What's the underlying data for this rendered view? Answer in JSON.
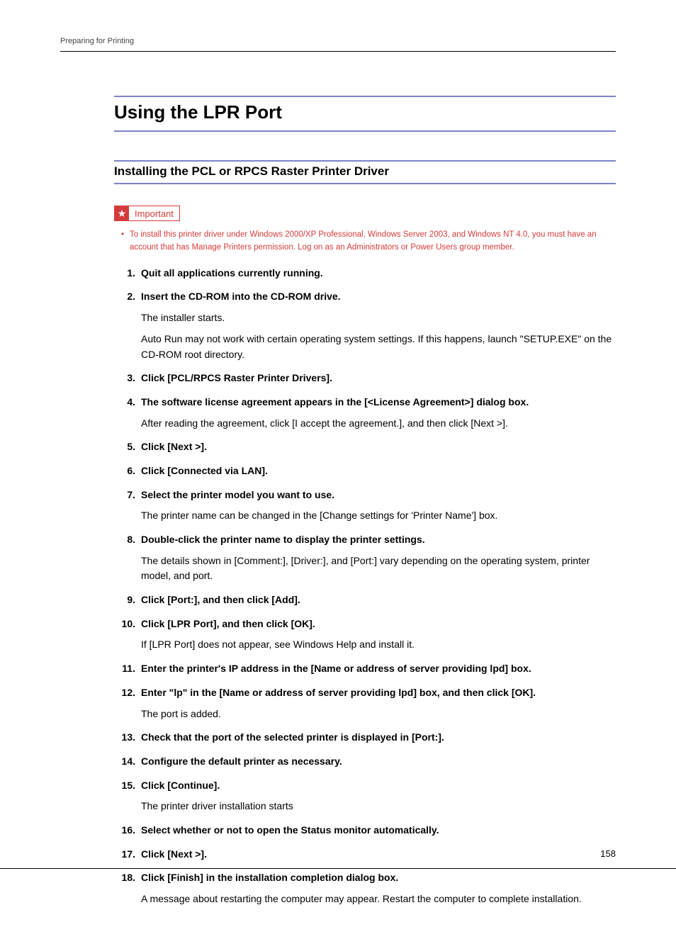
{
  "running_head": "Preparing for Printing",
  "page_title": "Using the LPR Port",
  "section_title": "Installing the PCL or RPCS Raster Printer Driver",
  "important_label": "Important",
  "important_note": "To install this printer driver under Windows 2000/XP Professional, Windows Server 2003, and Windows NT 4.0, you must have an account that has Manage Printers permission. Log on as an Administrators or Power Users group member.",
  "steps": [
    {
      "title": "Quit all applications currently running.",
      "body": []
    },
    {
      "title": "Insert the CD-ROM into the CD-ROM drive.",
      "body": [
        "The installer starts.",
        "Auto Run may not work with certain operating system settings. If this happens, launch \"SETUP.EXE\" on the CD-ROM root directory."
      ]
    },
    {
      "title": "Click [PCL/RPCS Raster Printer Drivers].",
      "body": []
    },
    {
      "title": "The software license agreement appears in the [<License Agreement>] dialog box.",
      "body": [
        "After reading the agreement, click [I accept the agreement.], and then click [Next >]."
      ]
    },
    {
      "title": "Click [Next >].",
      "body": []
    },
    {
      "title": "Click [Connected via LAN].",
      "body": []
    },
    {
      "title": "Select the printer model you want to use.",
      "body": [
        "The printer name can be changed in the [Change settings for 'Printer Name'] box."
      ]
    },
    {
      "title": "Double-click the printer name to display the printer settings.",
      "body": [
        "The details shown in [Comment:], [Driver:], and [Port:] vary depending on the operating system, printer model, and port."
      ]
    },
    {
      "title": "Click [Port:], and then click [Add].",
      "body": []
    },
    {
      "title": "Click [LPR Port], and then click [OK].",
      "body": [
        "If [LPR Port] does not appear, see Windows Help and install it."
      ]
    },
    {
      "title": "Enter the printer's IP address in the [Name or address of server providing lpd] box.",
      "body": []
    },
    {
      "title": "Enter \"lp\" in the [Name or address of server providing lpd] box, and then click [OK].",
      "body": [
        "The port is added."
      ]
    },
    {
      "title": "Check that the port of the selected printer is displayed in [Port:].",
      "body": []
    },
    {
      "title": "Configure the default printer as necessary.",
      "body": []
    },
    {
      "title": "Click [Continue].",
      "body": [
        "The printer driver installation starts"
      ]
    },
    {
      "title": "Select whether or not to open the Status monitor automatically.",
      "body": []
    },
    {
      "title": "Click [Next >].",
      "body": []
    },
    {
      "title": "Click [Finish] in the installation completion dialog box.",
      "body": [
        "A message about restarting the computer may appear. Restart the computer to complete installation."
      ]
    }
  ],
  "page_number": "158"
}
